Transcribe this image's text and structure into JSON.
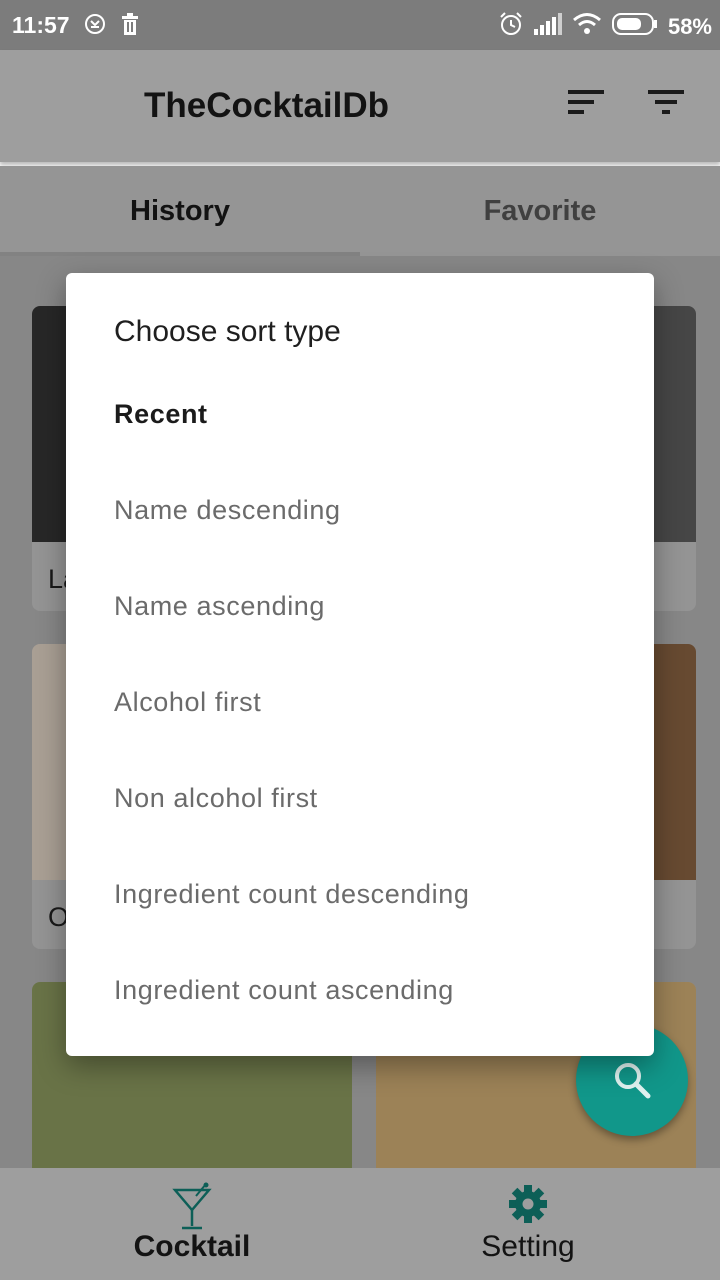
{
  "status_bar": {
    "time": "11:57",
    "battery_percent": "58%",
    "icons": [
      "sync-icon",
      "trash-icon",
      "alarm-icon",
      "signal-icon",
      "wifi-icon",
      "battery-icon"
    ]
  },
  "app_bar": {
    "title": "TheCocktailDb",
    "actions": [
      "sort-icon",
      "filter-icon"
    ]
  },
  "tabs": [
    {
      "label": "History",
      "active": true
    },
    {
      "label": "Favorite",
      "active": false
    }
  ],
  "grid": {
    "partial_labels": [
      "La",
      "O"
    ]
  },
  "sort_dialog": {
    "title": "Choose sort type",
    "options": [
      {
        "label": "Recent",
        "selected": true
      },
      {
        "label": "Name descending",
        "selected": false
      },
      {
        "label": "Name ascending",
        "selected": false
      },
      {
        "label": "Alcohol first",
        "selected": false
      },
      {
        "label": "Non alcohol first",
        "selected": false
      },
      {
        "label": "Ingredient count descending",
        "selected": false
      },
      {
        "label": "Ingredient count ascending",
        "selected": false
      }
    ]
  },
  "fab": {
    "icon": "search-icon"
  },
  "bottom_nav": {
    "items": [
      {
        "label": "Cocktail",
        "icon": "cocktail-glass-icon",
        "active": true
      },
      {
        "label": "Setting",
        "icon": "gear-icon",
        "active": false
      }
    ]
  },
  "colors": {
    "accent": "#11978a",
    "appbar": "#9e9e9e",
    "dialog_bg": "#ffffff"
  }
}
